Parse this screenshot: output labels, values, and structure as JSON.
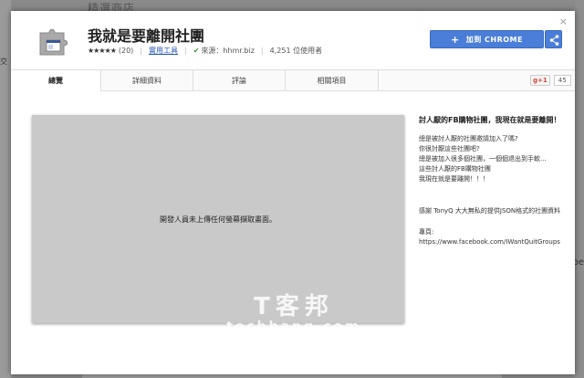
{
  "background": {
    "store_title": "精選商店",
    "left_text": "交",
    "right_text": "pe"
  },
  "extension": {
    "title": "我就是要離開社團",
    "stars": "★★★★★",
    "rating_count": "(20)",
    "category": "實用工具",
    "source_label": "來源：",
    "source": "hhmr.biz",
    "users": "4,251 位使用者"
  },
  "buttons": {
    "add_label": "加到 CHROME",
    "close": "×"
  },
  "tabs": [
    {
      "label": "總覽"
    },
    {
      "label": "詳細資料"
    },
    {
      "label": "評論"
    },
    {
      "label": "相關項目"
    }
  ],
  "gplus": {
    "label": "+1",
    "count": "45"
  },
  "screenshot": {
    "placeholder": "開發人員未上傳任何螢幕擷取畫面。"
  },
  "description": {
    "headline": "討人厭的FB購物社團，我現在就是要離開！",
    "lines1": [
      "總是被討人厭的社團邀請加入了嗎?",
      "你很討厭這些社團吧?",
      "總是被加入很多個社團，一個個退出到手軟...",
      "這些討人厭的FB購物社團",
      "我現在就是要離開！！！"
    ],
    "thanks": "感謝 TonyQ 大大無私的提供JSON格式的社團資料",
    "homepage_label": "專頁:",
    "homepage_url": "https://www.facebook.com/IWantQuitGroups"
  },
  "watermark": {
    "big": "T客邦",
    "small": "techbang.com"
  },
  "colors": {
    "accent": "#4a7ed8",
    "link": "#2a58b5"
  }
}
